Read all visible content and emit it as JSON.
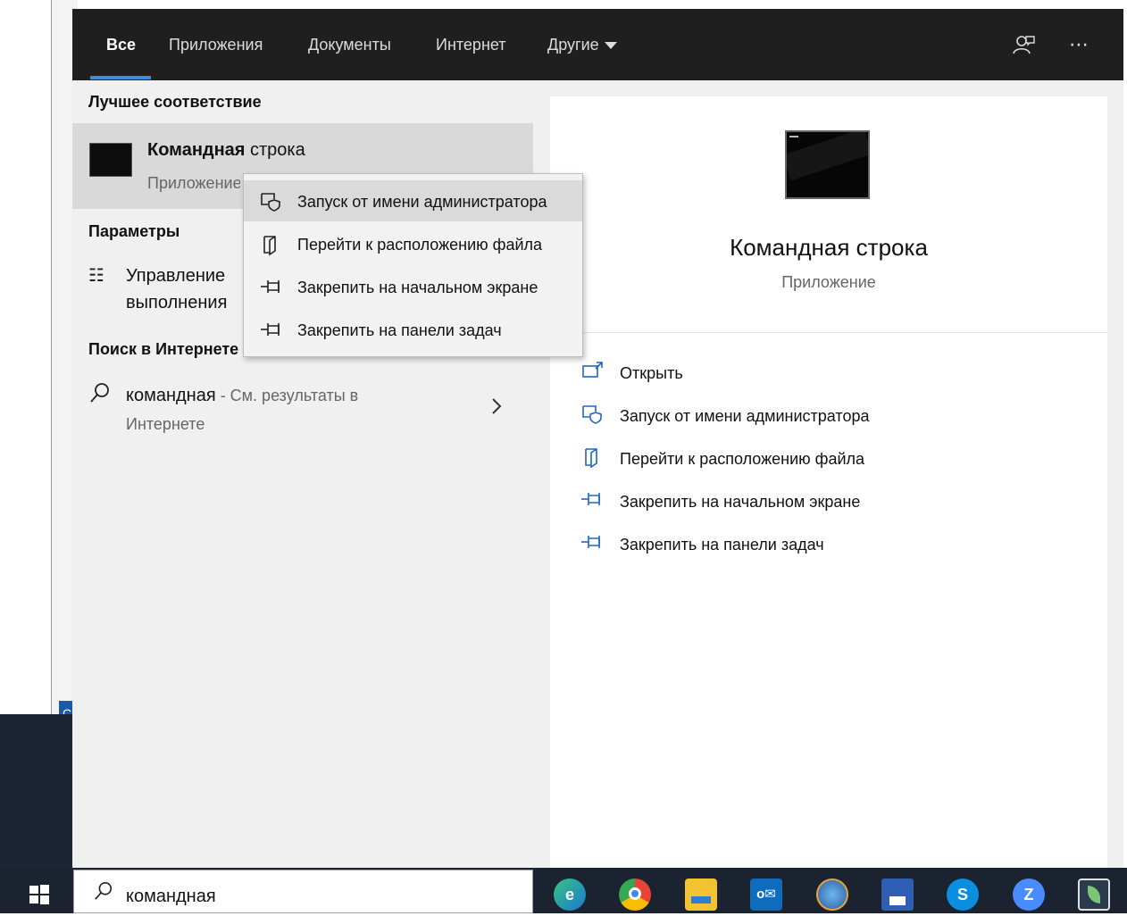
{
  "tabs": [
    {
      "label": "Все",
      "active": true
    },
    {
      "label": "Приложения",
      "active": false
    },
    {
      "label": "Документы",
      "active": false
    },
    {
      "label": "Интернет",
      "active": false
    },
    {
      "label": "Другие",
      "active": false
    }
  ],
  "topbar_icons": {
    "feedback": "feedback-icon",
    "more": "⋯"
  },
  "best_match": {
    "section_title": "Лучшее соответствие",
    "app_name_bold": "Командная",
    "app_name_rest": " строка",
    "app_type": "Приложение"
  },
  "settings": {
    "section_title": "Параметры",
    "item_line1": "Управление",
    "item_line2": "выполнения"
  },
  "web": {
    "section_title": "Поиск в Интернете",
    "query": "командная",
    "suffix": " - См. результаты в",
    "line2": "Интернете"
  },
  "context_menu": {
    "items": [
      {
        "icon": "admin-shield-icon",
        "label": "Запуск от имени администратора",
        "highlighted": true
      },
      {
        "icon": "file-location-icon",
        "label": "Перейти к расположению файла",
        "highlighted": false
      },
      {
        "icon": "pin-icon",
        "label": "Закрепить на начальном экране",
        "highlighted": false
      },
      {
        "icon": "pin-icon",
        "label": "Закрепить на панели задач",
        "highlighted": false
      }
    ]
  },
  "preview": {
    "title": "Командная строка",
    "subtitle": "Приложение",
    "actions": [
      {
        "icon": "open-icon",
        "label": "Открыть"
      },
      {
        "icon": "admin-shield-icon",
        "label": "Запуск от имени администратора"
      },
      {
        "icon": "file-location-icon",
        "label": "Перейти к расположению файла"
      },
      {
        "icon": "pin-icon",
        "label": "Закрепить на начальном экране"
      },
      {
        "icon": "pin-icon",
        "label": "Закрепить на панели задач"
      }
    ]
  },
  "background": {
    "strip_text": "C"
  },
  "taskbar": {
    "search_value": "командная",
    "apps": [
      "edge",
      "chrome",
      "file-explorer",
      "outlook",
      "globe",
      "floppy-save",
      "skype",
      "zoom",
      "app-leaf"
    ],
    "colors": {
      "accent": "#3c8fd8",
      "action_blue": "#1f66c1",
      "taskbar_bg": "#1c2330"
    }
  }
}
